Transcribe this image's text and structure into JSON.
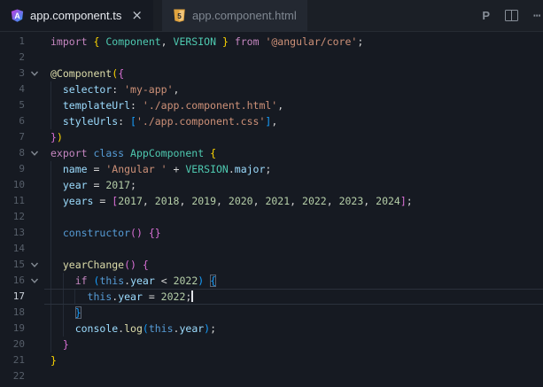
{
  "tab_bar": {
    "tabs": [
      {
        "label": "app.component.ts",
        "icon": "angular-icon",
        "active": true,
        "close_label": "×"
      },
      {
        "label": "app.component.html",
        "icon": "html5-icon",
        "active": false
      }
    ],
    "actions": {
      "prettier_label": "P",
      "split_editor": "split-editor-icon",
      "more_label": "⋯"
    }
  },
  "editor": {
    "language": "typescript",
    "cursor_line": 17,
    "colors": {
      "background": "#161a22",
      "tab_strip": "#1b1f26",
      "keyword_pink": "#C586C0",
      "keyword_blue": "#569CD6",
      "type_teal": "#4EC9B0",
      "variable_blue": "#9CDCFE",
      "function_yellow": "#DCDCAA",
      "string_orange": "#CE9178",
      "number_green": "#B5CEA8",
      "bracket_gold": "#FFD700",
      "bracket_orchid": "#DA70D6",
      "bracket_blue": "#179FFF",
      "angular_icon_blue": "#2e9bf7",
      "html5_icon_amber": "#e0a33e"
    },
    "lines": [
      {
        "n": 1,
        "fold": false,
        "guides": 0,
        "seg": [
          [
            "kw1",
            "import"
          ],
          [
            "d",
            " "
          ],
          [
            "b1",
            "{"
          ],
          [
            "d",
            " "
          ],
          [
            "ty",
            "Component"
          ],
          [
            "d",
            ", "
          ],
          [
            "ty",
            "VERSION"
          ],
          [
            "d",
            " "
          ],
          [
            "b1",
            "}"
          ],
          [
            "d",
            " "
          ],
          [
            "kw1",
            "from"
          ],
          [
            "d",
            " "
          ],
          [
            "str",
            "'@angular/core'"
          ],
          [
            "d",
            ";"
          ]
        ]
      },
      {
        "n": 2,
        "fold": false,
        "guides": 0,
        "seg": []
      },
      {
        "n": 3,
        "fold": true,
        "guides": 0,
        "seg": [
          [
            "fn",
            "@Component"
          ],
          [
            "b1",
            "("
          ],
          [
            "b2",
            "{"
          ]
        ]
      },
      {
        "n": 4,
        "fold": false,
        "guides": 1,
        "seg": [
          [
            "d",
            "  "
          ],
          [
            "var",
            "selector"
          ],
          [
            "d",
            ": "
          ],
          [
            "str",
            "'my-app'"
          ],
          [
            "d",
            ","
          ]
        ]
      },
      {
        "n": 5,
        "fold": false,
        "guides": 1,
        "seg": [
          [
            "d",
            "  "
          ],
          [
            "var",
            "templateUrl"
          ],
          [
            "d",
            ": "
          ],
          [
            "str",
            "'./app.component.html'"
          ],
          [
            "d",
            ","
          ]
        ]
      },
      {
        "n": 6,
        "fold": false,
        "guides": 1,
        "seg": [
          [
            "d",
            "  "
          ],
          [
            "var",
            "styleUrls"
          ],
          [
            "d",
            ": "
          ],
          [
            "b3",
            "["
          ],
          [
            "str",
            "'./app.component.css'"
          ],
          [
            "b3",
            "]"
          ],
          [
            "d",
            ","
          ]
        ]
      },
      {
        "n": 7,
        "fold": false,
        "guides": 0,
        "seg": [
          [
            "b2",
            "}"
          ],
          [
            "b1",
            ")"
          ]
        ]
      },
      {
        "n": 8,
        "fold": true,
        "guides": 0,
        "seg": [
          [
            "kw1",
            "export"
          ],
          [
            "d",
            " "
          ],
          [
            "kw2",
            "class"
          ],
          [
            "d",
            " "
          ],
          [
            "ty",
            "AppComponent"
          ],
          [
            "d",
            " "
          ],
          [
            "b1",
            "{"
          ]
        ]
      },
      {
        "n": 9,
        "fold": false,
        "guides": 1,
        "seg": [
          [
            "d",
            "  "
          ],
          [
            "var",
            "name"
          ],
          [
            "d",
            " = "
          ],
          [
            "str",
            "'Angular '"
          ],
          [
            "d",
            " + "
          ],
          [
            "ty",
            "VERSION"
          ],
          [
            "d",
            "."
          ],
          [
            "var",
            "major"
          ],
          [
            "d",
            ";"
          ]
        ]
      },
      {
        "n": 10,
        "fold": false,
        "guides": 1,
        "seg": [
          [
            "d",
            "  "
          ],
          [
            "var",
            "year"
          ],
          [
            "d",
            " = "
          ],
          [
            "num",
            "2017"
          ],
          [
            "d",
            ";"
          ]
        ]
      },
      {
        "n": 11,
        "fold": false,
        "guides": 1,
        "seg": [
          [
            "d",
            "  "
          ],
          [
            "var",
            "years"
          ],
          [
            "d",
            " = "
          ],
          [
            "b2",
            "["
          ],
          [
            "num",
            "2017"
          ],
          [
            "d",
            ", "
          ],
          [
            "num",
            "2018"
          ],
          [
            "d",
            ", "
          ],
          [
            "num",
            "2019"
          ],
          [
            "d",
            ", "
          ],
          [
            "num",
            "2020"
          ],
          [
            "d",
            ", "
          ],
          [
            "num",
            "2021"
          ],
          [
            "d",
            ", "
          ],
          [
            "num",
            "2022"
          ],
          [
            "d",
            ", "
          ],
          [
            "num",
            "2023"
          ],
          [
            "d",
            ", "
          ],
          [
            "num",
            "2024"
          ],
          [
            "b2",
            "]"
          ],
          [
            "d",
            ";"
          ]
        ]
      },
      {
        "n": 12,
        "fold": false,
        "guides": 1,
        "seg": []
      },
      {
        "n": 13,
        "fold": false,
        "guides": 1,
        "seg": [
          [
            "d",
            "  "
          ],
          [
            "kw2",
            "constructor"
          ],
          [
            "b2",
            "("
          ],
          [
            "b2",
            ")"
          ],
          [
            "d",
            " "
          ],
          [
            "b2",
            "{"
          ],
          [
            "b2",
            "}"
          ]
        ]
      },
      {
        "n": 14,
        "fold": false,
        "guides": 1,
        "seg": []
      },
      {
        "n": 15,
        "fold": true,
        "guides": 1,
        "seg": [
          [
            "d",
            "  "
          ],
          [
            "fn",
            "yearChange"
          ],
          [
            "b2",
            "("
          ],
          [
            "b2",
            ")"
          ],
          [
            "d",
            " "
          ],
          [
            "b2",
            "{"
          ]
        ]
      },
      {
        "n": 16,
        "fold": true,
        "guides": 2,
        "seg": [
          [
            "d",
            "    "
          ],
          [
            "kw1",
            "if"
          ],
          [
            "d",
            " "
          ],
          [
            "b3",
            "("
          ],
          [
            "kw2",
            "this"
          ],
          [
            "d",
            "."
          ],
          [
            "var",
            "year"
          ],
          [
            "d",
            " < "
          ],
          [
            "num",
            "2022"
          ],
          [
            "b3",
            ")"
          ],
          [
            "d",
            " "
          ],
          [
            "b3m",
            "{"
          ]
        ]
      },
      {
        "n": 17,
        "fold": false,
        "guides": 3,
        "seg": [
          [
            "d",
            "      "
          ],
          [
            "kw2",
            "this"
          ],
          [
            "d",
            "."
          ],
          [
            "var",
            "year"
          ],
          [
            "d",
            " = "
          ],
          [
            "num",
            "2022"
          ],
          [
            "d",
            ";"
          ]
        ]
      },
      {
        "n": 18,
        "fold": false,
        "guides": 2,
        "seg": [
          [
            "d",
            "    "
          ],
          [
            "b3m",
            "}"
          ]
        ]
      },
      {
        "n": 19,
        "fold": false,
        "guides": 2,
        "seg": [
          [
            "d",
            "    "
          ],
          [
            "var",
            "console"
          ],
          [
            "d",
            "."
          ],
          [
            "fn",
            "log"
          ],
          [
            "b3",
            "("
          ],
          [
            "kw2",
            "this"
          ],
          [
            "d",
            "."
          ],
          [
            "var",
            "year"
          ],
          [
            "b3",
            ")"
          ],
          [
            "d",
            ";"
          ]
        ]
      },
      {
        "n": 20,
        "fold": false,
        "guides": 1,
        "seg": [
          [
            "d",
            "  "
          ],
          [
            "b2",
            "}"
          ]
        ]
      },
      {
        "n": 21,
        "fold": false,
        "guides": 0,
        "seg": [
          [
            "b1",
            "}"
          ]
        ]
      },
      {
        "n": 22,
        "fold": false,
        "guides": 0,
        "seg": []
      }
    ]
  }
}
